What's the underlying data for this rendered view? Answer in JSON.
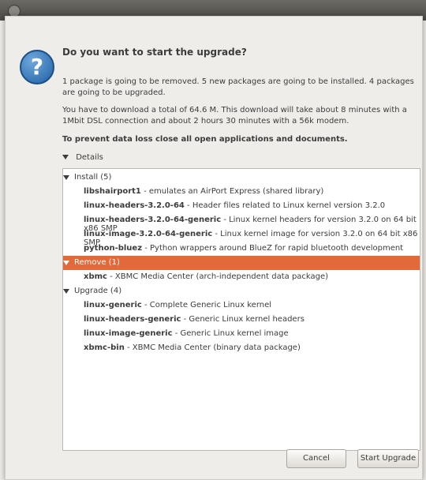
{
  "dialog": {
    "title": "Do you want to start the upgrade?",
    "message_1": "1 package is going to be removed. 5 new packages are going to be installed. 4 packages are going to be upgraded.",
    "message_2": "You have to download a total of 64.6 M. This download will take about 8 minutes with a 1Mbit DSL connection and about 2 hours 30 minutes with a 56k modem.",
    "warning": "To prevent data loss close all open applications and documents.",
    "details_label": "Details",
    "buttons": {
      "cancel": "Cancel",
      "start": "Start Upgrade"
    }
  },
  "groups": [
    {
      "label": "Install (5)",
      "items": [
        {
          "name": "libshairport1",
          "desc": " - emulates an AirPort Express (shared library)"
        },
        {
          "name": "linux-headers-3.2.0-64",
          "desc": " - Header files related to Linux kernel version 3.2.0"
        },
        {
          "name": "linux-headers-3.2.0-64-generic",
          "desc": " - Linux kernel headers for version 3.2.0 on 64 bit x86 SMP"
        },
        {
          "name": "linux-image-3.2.0-64-generic",
          "desc": " - Linux kernel image for version 3.2.0 on 64 bit x86 SMP"
        },
        {
          "name": "python-bluez",
          "desc": " - Python wrappers around BlueZ for rapid bluetooth development"
        }
      ]
    },
    {
      "label": "Remove (1)",
      "items": [
        {
          "name": "xbmc",
          "desc": " - XBMC Media Center (arch-independent data package)"
        }
      ]
    },
    {
      "label": "Upgrade (4)",
      "items": [
        {
          "name": "linux-generic",
          "desc": " - Complete Generic Linux kernel"
        },
        {
          "name": "linux-headers-generic",
          "desc": " - Generic Linux kernel headers"
        },
        {
          "name": "linux-image-generic",
          "desc": " - Generic Linux kernel image"
        },
        {
          "name": "xbmc-bin",
          "desc": " - XBMC Media Center (binary data package)"
        }
      ]
    }
  ],
  "colors": {
    "selected_row": "#e2693a",
    "icon_blue": "#1f5fa3"
  }
}
